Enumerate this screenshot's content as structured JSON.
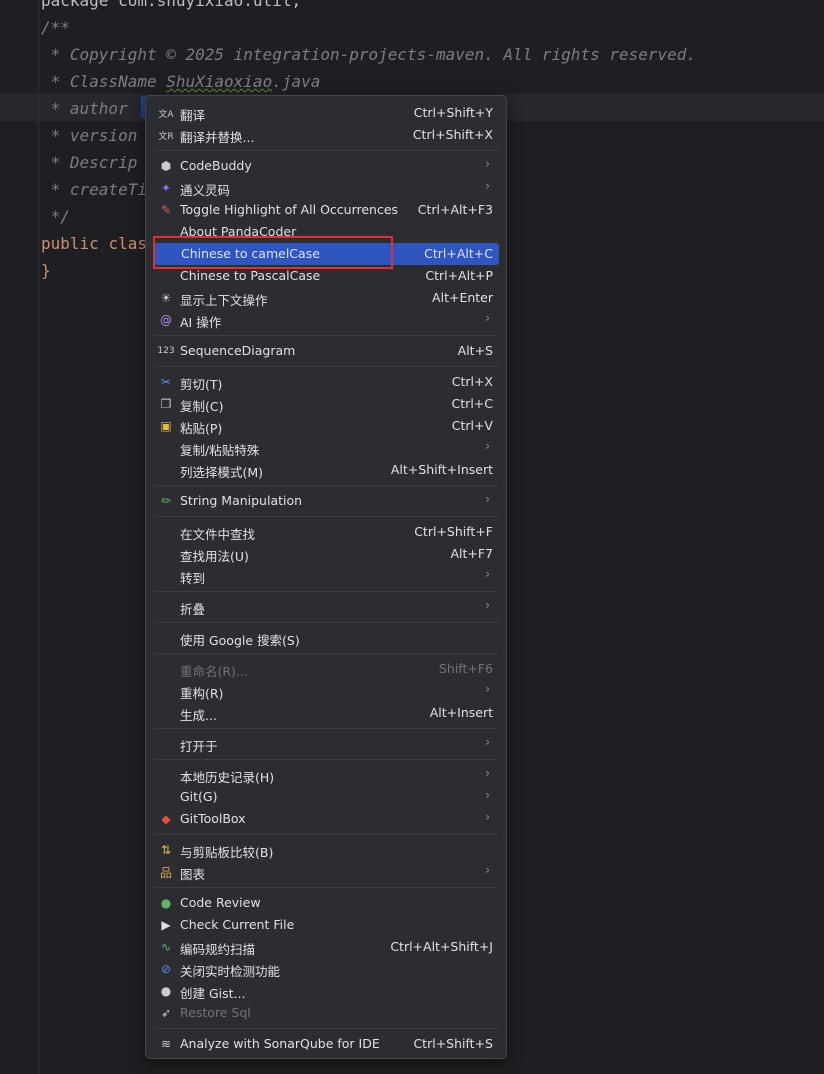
{
  "editor": {
    "lines": [
      {
        "segments": [
          {
            "t": "package com.shuyixiao.util;",
            "c": ""
          }
        ]
      },
      {
        "segments": [
          {
            "t": "/**",
            "c": "cmt"
          }
        ]
      },
      {
        "segments": [
          {
            "t": " * Copyright © 2025 integration-projects-maven. All rights reserved.",
            "c": "cmt"
          }
        ]
      },
      {
        "segments": [
          {
            "t": " * ClassName ",
            "c": "cmt"
          },
          {
            "t": "ShuXiaoxiao",
            "c": "cmt squig"
          },
          {
            "t": ".java",
            "c": "cmt"
          }
        ]
      },
      {
        "segments": [
          {
            "t": " * author ",
            "c": "cmt"
          }
        ]
      },
      {
        "segments": [
          {
            "t": " * version",
            "c": "cmt"
          }
        ]
      },
      {
        "segments": [
          {
            "t": " * Descrip",
            "c": "cmt"
          }
        ]
      },
      {
        "segments": [
          {
            "t": " * createTi",
            "c": "cmt"
          }
        ]
      },
      {
        "segments": [
          {
            "t": " */",
            "c": "cmt"
          }
        ]
      },
      {
        "segments": [
          {
            "t": "public ",
            "c": "kw"
          },
          {
            "t": "clas",
            "c": "kw"
          }
        ]
      },
      {
        "segments": [
          {
            "t": "}",
            "c": "kw"
          }
        ]
      }
    ]
  },
  "menu": {
    "items": [
      {
        "name": "translate",
        "icon": "translate-icon",
        "glyph": "文A",
        "label": "翻译",
        "shortcut": "Ctrl+Shift+Y"
      },
      {
        "name": "translate-replace",
        "icon": "translate-replace-icon",
        "glyph": "文R",
        "label": "翻译并替换...",
        "shortcut": "Ctrl+Shift+X"
      },
      {
        "sep": true
      },
      {
        "name": "codebuddy",
        "icon": "codebuddy-icon",
        "glyph": "⬢",
        "label": "CodeBuddy",
        "submenu": true
      },
      {
        "name": "tongyi-lingma",
        "icon": "tongyi-icon",
        "glyph": "✦",
        "label": "通义灵码",
        "submenu": true
      },
      {
        "name": "toggle-highlight",
        "icon": "highlighter-icon",
        "glyph": "✎",
        "label": "Toggle Highlight of All Occurrences",
        "shortcut": "Ctrl+Alt+F3"
      },
      {
        "name": "about-pandacoder",
        "icon": "",
        "glyph": "",
        "label": "About PandaCoder"
      },
      {
        "name": "chinese-to-camelcase",
        "icon": "",
        "glyph": "",
        "label": "Chinese to camelCase",
        "shortcut": "Ctrl+Alt+C",
        "highlight": true
      },
      {
        "name": "chinese-to-pascalcase",
        "icon": "",
        "glyph": "",
        "label": "Chinese to PascalCase",
        "shortcut": "Ctrl+Alt+P"
      },
      {
        "name": "context-actions",
        "icon": "lightbulb-icon",
        "glyph": "☀",
        "label": "显示上下文操作",
        "shortcut": "Alt+Enter"
      },
      {
        "name": "ai-actions",
        "icon": "ai-spiral-icon",
        "glyph": "@",
        "label": "AI 操作",
        "submenu": true
      },
      {
        "sep": true
      },
      {
        "name": "sequence-diagram",
        "icon": "sequence-icon",
        "glyph": "123",
        "label": "SequenceDiagram",
        "shortcut": "Alt+S"
      },
      {
        "sep": true
      },
      {
        "name": "cut",
        "icon": "scissors-icon",
        "glyph": "✂",
        "label": "剪切(T)",
        "shortcut": "Ctrl+X"
      },
      {
        "name": "copy",
        "icon": "copy-icon",
        "glyph": "❐",
        "label": "复制(C)",
        "shortcut": "Ctrl+C"
      },
      {
        "name": "paste",
        "icon": "clipboard-icon",
        "glyph": "▣",
        "label": "粘贴(P)",
        "shortcut": "Ctrl+V"
      },
      {
        "name": "copy-paste-special",
        "icon": "",
        "glyph": "",
        "label": "复制/粘贴特殊",
        "submenu": true
      },
      {
        "name": "column-selection",
        "icon": "",
        "glyph": "",
        "label": "列选择模式(M)",
        "shortcut": "Alt+Shift+Insert"
      },
      {
        "sep": true
      },
      {
        "name": "string-manipulation",
        "icon": "pencil-icon",
        "glyph": "✏",
        "label": "String Manipulation",
        "submenu": true
      },
      {
        "sep": true
      },
      {
        "name": "find-in-files",
        "icon": "",
        "glyph": "",
        "label": "在文件中查找",
        "shortcut": "Ctrl+Shift+F"
      },
      {
        "name": "find-usages",
        "icon": "",
        "glyph": "",
        "label": "查找用法(U)",
        "shortcut": "Alt+F7"
      },
      {
        "name": "goto",
        "icon": "",
        "glyph": "",
        "label": "转到",
        "submenu": true
      },
      {
        "sep": true
      },
      {
        "name": "folding",
        "icon": "",
        "glyph": "",
        "label": "折叠",
        "submenu": true
      },
      {
        "sep": true
      },
      {
        "name": "google-search",
        "icon": "",
        "glyph": "",
        "label": "使用 Google 搜索(S)"
      },
      {
        "sep": true
      },
      {
        "name": "rename",
        "icon": "",
        "glyph": "",
        "label": "重命名(R)...",
        "shortcut": "Shift+F6",
        "disabled": true
      },
      {
        "name": "refactor",
        "icon": "",
        "glyph": "",
        "label": "重构(R)",
        "submenu": true
      },
      {
        "name": "generate",
        "icon": "",
        "glyph": "",
        "label": "生成...",
        "shortcut": "Alt+Insert"
      },
      {
        "sep": true
      },
      {
        "name": "open-in",
        "icon": "",
        "glyph": "",
        "label": "打开于",
        "submenu": true
      },
      {
        "sep": true
      },
      {
        "name": "local-history",
        "icon": "",
        "glyph": "",
        "label": "本地历史记录(H)",
        "submenu": true
      },
      {
        "name": "git",
        "icon": "",
        "glyph": "",
        "label": "Git(G)",
        "submenu": true
      },
      {
        "name": "gittoolbox",
        "icon": "gittoolbox-icon",
        "glyph": "◆",
        "label": "GitToolBox",
        "submenu": true
      },
      {
        "sep": true
      },
      {
        "name": "compare-clipboard",
        "icon": "compare-icon",
        "glyph": "⇅",
        "label": "与剪贴板比较(B)"
      },
      {
        "name": "diagrams",
        "icon": "diagram-icon",
        "glyph": "品",
        "label": "图表",
        "submenu": true
      },
      {
        "sep": true
      },
      {
        "name": "code-review",
        "icon": "code-review-icon",
        "glyph": "●",
        "label": "Code Review"
      },
      {
        "name": "check-current-file",
        "icon": "play-icon",
        "glyph": "▶",
        "label": "Check Current File"
      },
      {
        "name": "coding-spec-scan",
        "icon": "scan-icon",
        "glyph": "∿",
        "label": "编码规约扫描",
        "shortcut": "Ctrl+Alt+Shift+J"
      },
      {
        "name": "close-realtime-detect",
        "icon": "prohibit-icon",
        "glyph": "⊘",
        "label": "关闭实时检测功能"
      },
      {
        "name": "create-gist",
        "icon": "github-icon",
        "glyph": "●",
        "label": "创建 Gist..."
      },
      {
        "name": "restore-sql",
        "icon": "restore-sql-icon",
        "glyph": "➶",
        "label": "Restore Sql",
        "disabled": true
      },
      {
        "sep": true
      },
      {
        "name": "sonarqube",
        "icon": "sonarqube-icon",
        "glyph": "≋",
        "label": "Analyze with SonarQube for IDE",
        "shortcut": "Ctrl+Shift+S"
      }
    ]
  },
  "colors": {
    "codebuddy": "#c9ccd2",
    "tongyi": "#8f6dfb",
    "highlighter": "#e05a4f",
    "ai": "#b28cf0",
    "scissors": "#5b8ff9",
    "copy": "#c9ccd2",
    "clipboard": "#e8b64c",
    "pencil": "#5fb85f",
    "gittoolbox": "#e0533c",
    "compare": "#e8b64c",
    "diagram": "#d6a845",
    "codereview": "#5fb85f",
    "play": "#dfe1e5",
    "scan": "#5fb85f",
    "prohibit": "#4f8ff7"
  }
}
